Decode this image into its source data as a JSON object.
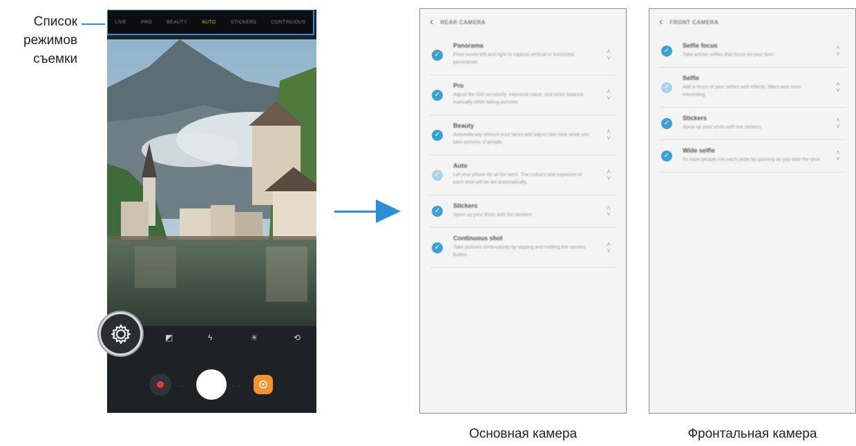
{
  "callout": {
    "lines": [
      "Список",
      "режимов",
      "съемки"
    ]
  },
  "phone": {
    "modes": [
      "Live",
      "Pro",
      "Beauty",
      "Auto",
      "Stickers",
      "Continuous"
    ],
    "active_mode": "Auto",
    "icons": [
      "settings-icon",
      "hdr-icon",
      "flash-off-icon",
      "filter-icon",
      "switch-camera-icon",
      "record-icon",
      "shutter",
      "bixby-icon"
    ]
  },
  "rear": {
    "title": "Rear camera",
    "items": [
      {
        "title": "Panorama",
        "desc": "Pivot slowly left and right to capture vertical or horizontal panoramas.",
        "enabled": true
      },
      {
        "title": "Pro",
        "desc": "Adjust the ISO sensitivity, exposure value, and white balance manually while taking pictures.",
        "enabled": true
      },
      {
        "title": "Beauty",
        "desc": "Automatically retouch your faces and adjust skin tone while you take pictures of people.",
        "enabled": true
      },
      {
        "title": "Auto",
        "desc": "Let your phone do all the work. The colours and exposure of each shot will be set automatically.",
        "enabled": false
      },
      {
        "title": "Stickers",
        "desc": "Spice up your shots with fun stickers.",
        "enabled": true
      },
      {
        "title": "Continuous shot",
        "desc": "Take pictures continuously by tapping and holding the camera button.",
        "enabled": true
      }
    ],
    "caption": "Основная камера"
  },
  "front": {
    "title": "Front camera",
    "items": [
      {
        "title": "Selfie focus",
        "desc": "Take artistic selfies that focus on your face.",
        "enabled": true
      },
      {
        "title": "Selfie",
        "desc": "Add a touch of your selfies with effects, filters and more interesting.",
        "enabled": false
      },
      {
        "title": "Stickers",
        "desc": "Spice up your shots with fun stickers.",
        "enabled": true
      },
      {
        "title": "Wide selfie",
        "desc": "Fit more people into each selfie by panning as you take the shot.",
        "enabled": true
      }
    ],
    "caption": "Фронтальная камера"
  },
  "colors": {
    "accent": "#2a8fd6",
    "check": "#3aa0d5",
    "active_mode": "#e5c82d",
    "record": "#e43a3a"
  }
}
